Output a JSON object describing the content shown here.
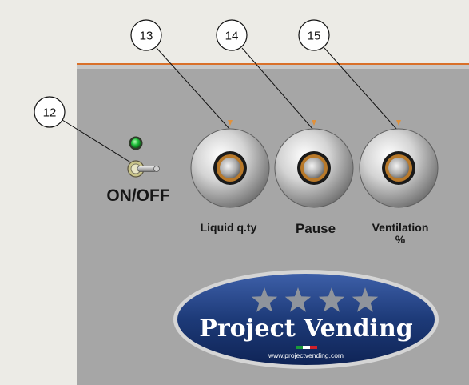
{
  "callouts": [
    {
      "number": "12",
      "target": "on-off-switch"
    },
    {
      "number": "13",
      "target": "liquid-qty-knob"
    },
    {
      "number": "14",
      "target": "pause-knob"
    },
    {
      "number": "15",
      "target": "ventilation-knob"
    }
  ],
  "switch": {
    "label": "ON/OFF",
    "led_color": "#1fbf3a"
  },
  "knobs": [
    {
      "id": "liquid",
      "label_lines": [
        "Liquid q.ty"
      ]
    },
    {
      "id": "pause",
      "label_lines": [
        "Pause"
      ]
    },
    {
      "id": "ventilation",
      "label_lines": [
        "Ventilation",
        "%"
      ]
    }
  ],
  "brand": {
    "title": "Project Vending",
    "url": "www.projectvending.com",
    "star_count": 4,
    "colors": {
      "oval": "#1d3a78",
      "star": "#8f949c",
      "flag": [
        "#1a9a3a",
        "#ffffff",
        "#d0202a"
      ]
    }
  },
  "panel": {
    "color": "#a6a6a6",
    "stripe_color": "#d9702a"
  }
}
